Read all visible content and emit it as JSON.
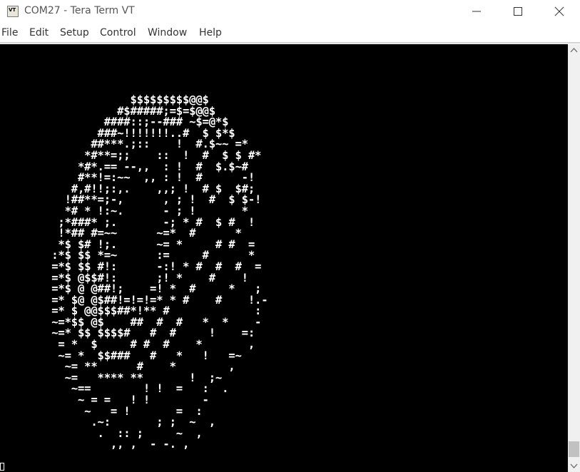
{
  "window": {
    "title": "COM27 - Tera Term VT",
    "app_icon": "VT",
    "controls": [
      "minimize-icon",
      "maximize-icon",
      "close-icon"
    ]
  },
  "menu": [
    "File",
    "Edit",
    "Setup",
    "Control",
    "Window",
    "Help"
  ],
  "terminal": {
    "background": "#000000",
    "foreground": "#ffffff",
    "lines": [
      "             $$$$$$$$$@@$",
      "           #$#####;=$=$@@$",
      "         ####::;--### ~$=@*$",
      "        ###~!!!!!!!..#  $ $*$",
      "       ##***.;::    !  #.$~~ =*",
      "      *#**=;;    ::  !  #  $ $ #*",
      "     *#*.== --,,  : !  #  $.$~#",
      "     #**!=:~~  ,, : !  #      -!",
      "    #,#!!;:,.    ,,; !  # $  $#;",
      "   !##**=;-,      , ; !  #  $ $-!",
      "   *# * !:~.      - ; !       *",
      "  ;*###* ;.       -; * #  $ #  !",
      "  !*## #=~~      ~=*  #      *",
      "  *$ $# !;.      ~= *     # #  =",
      " :*$ $$ *=~      :=     #      *",
      " =*$ $$ #!:      -:! * #  #  #  =",
      " =*$ @$$#!:      ;! *    #    !",
      " =*$ @ @##!;    =! *  #     *   ;",
      " =* $@ @$##!=!=!=* * #    #    !.-",
      " =* $ @@$$$##*!** #             :",
      " ~=*$$ @$    ##  #  #   *  *    -",
      " ~=* $$ $$$$#   #  #     !    =:",
      "  = *  $     # #  #    *       ,",
      "  ~= *  $$###   #   *   !   =~",
      "   ~= **      #    *        ,",
      "   ~=   **** **       !  ;~",
      "    ~==        ! !  =   :  .",
      "     ~ = =   ! !        -",
      "      ~   = !       =  :",
      "       .~:       ; ;  ~  ,",
      "        .  :: ;     ~  ,",
      "          ,, ,  - -. ,"
    ]
  },
  "scrollbar": {
    "up": "chevron-up-icon",
    "down": "chevron-down-icon",
    "position": 0.95
  }
}
